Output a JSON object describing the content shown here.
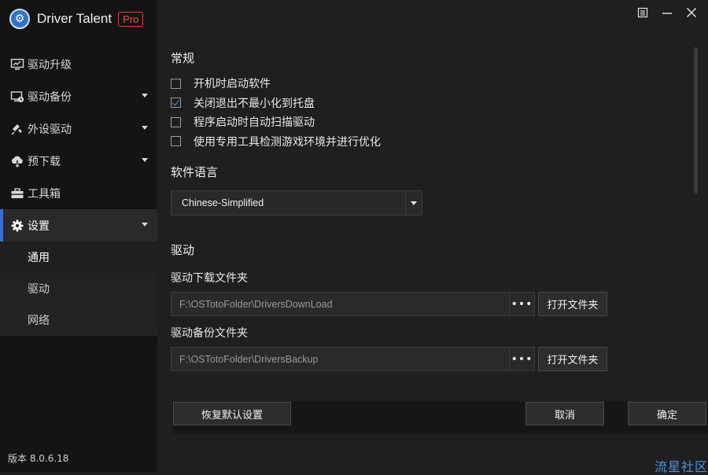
{
  "app": {
    "title": "Driver Talent",
    "badge": "Pro",
    "version": "版本 8.0.6.18"
  },
  "window_controls": {
    "icons": [
      "menu-icon",
      "minimize-icon",
      "close-icon"
    ]
  },
  "sidebar": {
    "items": [
      {
        "label": "驱动升级",
        "icon": "monitor-icon",
        "caret": false
      },
      {
        "label": "驱动备份",
        "icon": "backup-icon",
        "caret": true
      },
      {
        "label": "外设驱动",
        "icon": "peripheral-icon",
        "caret": true
      },
      {
        "label": "预下载",
        "icon": "cloud-download-icon",
        "caret": true
      },
      {
        "label": "工具箱",
        "icon": "toolbox-icon",
        "caret": false
      },
      {
        "label": "设置",
        "icon": "gear-icon",
        "caret": true,
        "active": true
      }
    ],
    "sub_items": [
      {
        "label": "通用",
        "active": true
      },
      {
        "label": "驱动"
      },
      {
        "label": "网络"
      }
    ]
  },
  "general": {
    "title": "常规",
    "options": [
      {
        "label": "开机时启动软件",
        "checked": false
      },
      {
        "label": "关闭退出不最小化到托盘",
        "checked": true
      },
      {
        "label": "程序启动时自动扫描驱动",
        "checked": false
      },
      {
        "label": "使用专用工具检测游戏环境并进行优化",
        "checked": false
      }
    ]
  },
  "language": {
    "title": "软件语言",
    "selected": "Chinese-Simplified"
  },
  "driver": {
    "title": "驱动",
    "download_label": "驱动下载文件夹",
    "download_path": "F:\\OSTotoFolder\\DriversDownLoad",
    "backup_label": "驱动备份文件夹",
    "backup_path": "F:\\OSTotoFolder\\DriversBackup",
    "browse_label": "•••",
    "open_folder_label": "打开文件夹"
  },
  "footer": {
    "reset_label": "恢复默认设置",
    "cancel_label": "取消",
    "ok_label": "确定"
  },
  "watermark": "流星社区",
  "colors": {
    "accent": "#3b6fd0",
    "checkmark": "#4a8de6",
    "badge": "#d9443a",
    "sidebar_bg": "#141414",
    "content_bg": "#1f1f1f"
  }
}
